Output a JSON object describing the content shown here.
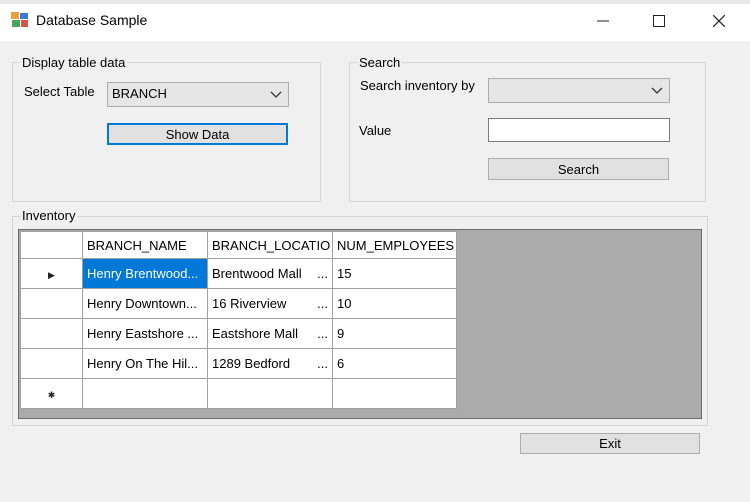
{
  "window": {
    "title": "Database Sample",
    "minimize": "—",
    "maximize": "☐",
    "close": "✕"
  },
  "display_group": {
    "label": "Display table data",
    "select_label": "Select Table",
    "select_value": "BRANCH",
    "show_button": "Show Data"
  },
  "search_group": {
    "label": "Search",
    "search_by_label": "Search inventory by",
    "search_by_value": "",
    "value_label": "Value",
    "value_input": "",
    "search_button": "Search"
  },
  "inventory_group": {
    "label": "Inventory",
    "columns": [
      "BRANCH_NAME",
      "BRANCH_LOCATIO",
      "NUM_EMPLOYEES"
    ],
    "rows": [
      {
        "name": "Henry Brentwood...",
        "location": "Brentwood Mall",
        "employees": "15",
        "selected": true
      },
      {
        "name": "Henry Downtown...",
        "location": "16 Riverview",
        "employees": "10"
      },
      {
        "name": "Henry Eastshore ...",
        "location": "Eastshore Mall",
        "employees": "9"
      },
      {
        "name": "Henry On The Hil...",
        "location": "1289 Bedford",
        "employees": "6"
      }
    ],
    "ellipsis": "...",
    "current_row_marker": "▶",
    "new_row_marker": "✱"
  },
  "exit_button": "Exit",
  "colors": {
    "selection": "#0078d7",
    "focus_border": "#0078d7",
    "grid_background": "#ababab"
  }
}
